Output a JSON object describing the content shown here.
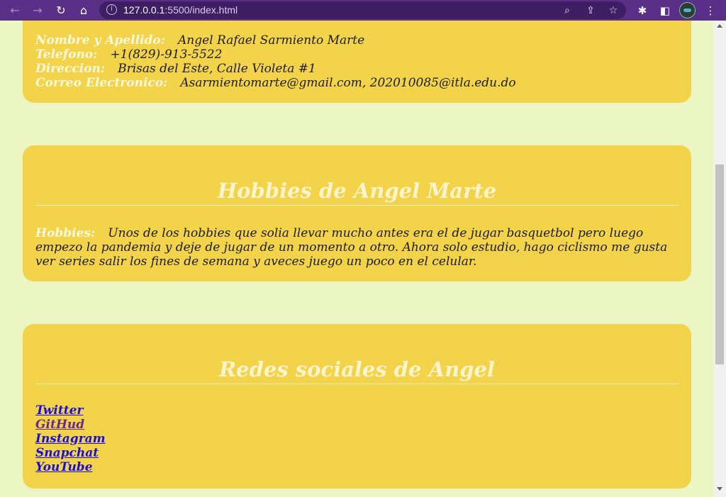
{
  "browser": {
    "url_host": "127.0.0.1",
    "url_rest": ":5500/index.html",
    "colors": {
      "toolbar": "#5a2f88",
      "omnibox": "#3e1f63"
    },
    "icons": [
      "back-arrow-icon",
      "forward-arrow-icon",
      "reload-icon",
      "home-icon",
      "site-info-icon",
      "zoom-icon",
      "share-icon",
      "bookmark-star-icon",
      "extensions-puzzle-icon",
      "side-panel-icon",
      "profile-avatar",
      "kebab-menu-icon"
    ]
  },
  "page": {
    "background": "#ecf6c2",
    "card_color": "#f2d34a",
    "contact": {
      "name_label": "Nombre y Apellido:",
      "name_value": "Angel Rafael Sarmiento Marte",
      "phone_label": "Telefono:",
      "phone_value": "+1(829)-913-5522",
      "address_label": "Direccion:",
      "address_value": "Brisas del Este, Calle Violeta #1",
      "email_label": "Correo Electronico:",
      "email_value": "Asarmientomarte@gmail.com, 202010085@itla.edu.do"
    },
    "hobbies": {
      "title": "Hobbies de Angel Marte",
      "label": "Hobbies:",
      "text": "Unos de los hobbies que solia llevar mucho antes era el de jugar basquetbol pero luego empezo la pandemia y deje de jugar de un momento a otro. Ahora solo estudio, hago ciclismo me gusta ver series salir los fines de semana y aveces juego un poco en el celular."
    },
    "social": {
      "title": "Redes sociales de Angel",
      "links": [
        "Twitter",
        "GitHud",
        "Instagram",
        "Snapchat",
        "YouTube"
      ]
    }
  }
}
